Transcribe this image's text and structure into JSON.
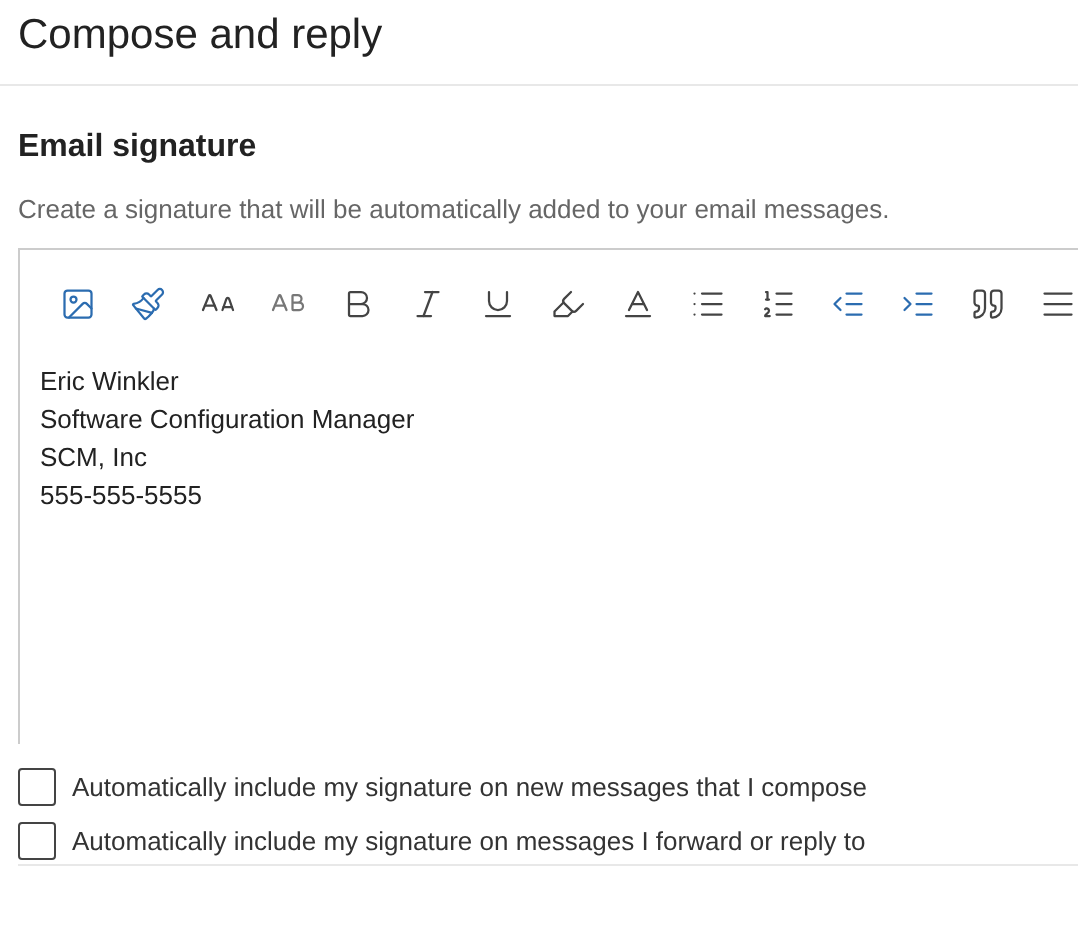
{
  "page_title": "Compose and reply",
  "section": {
    "title": "Email signature",
    "description": "Create a signature that will be automatically added to your email messages."
  },
  "signature_lines": [
    "Eric Winkler",
    "Software Configuration Manager",
    "SCM, Inc",
    "555-555-5555"
  ],
  "options": [
    {
      "label": "Automatically include my signature on new messages that I compose",
      "checked": false
    },
    {
      "label": "Automatically include my signature on messages I forward or reply to",
      "checked": false
    }
  ]
}
